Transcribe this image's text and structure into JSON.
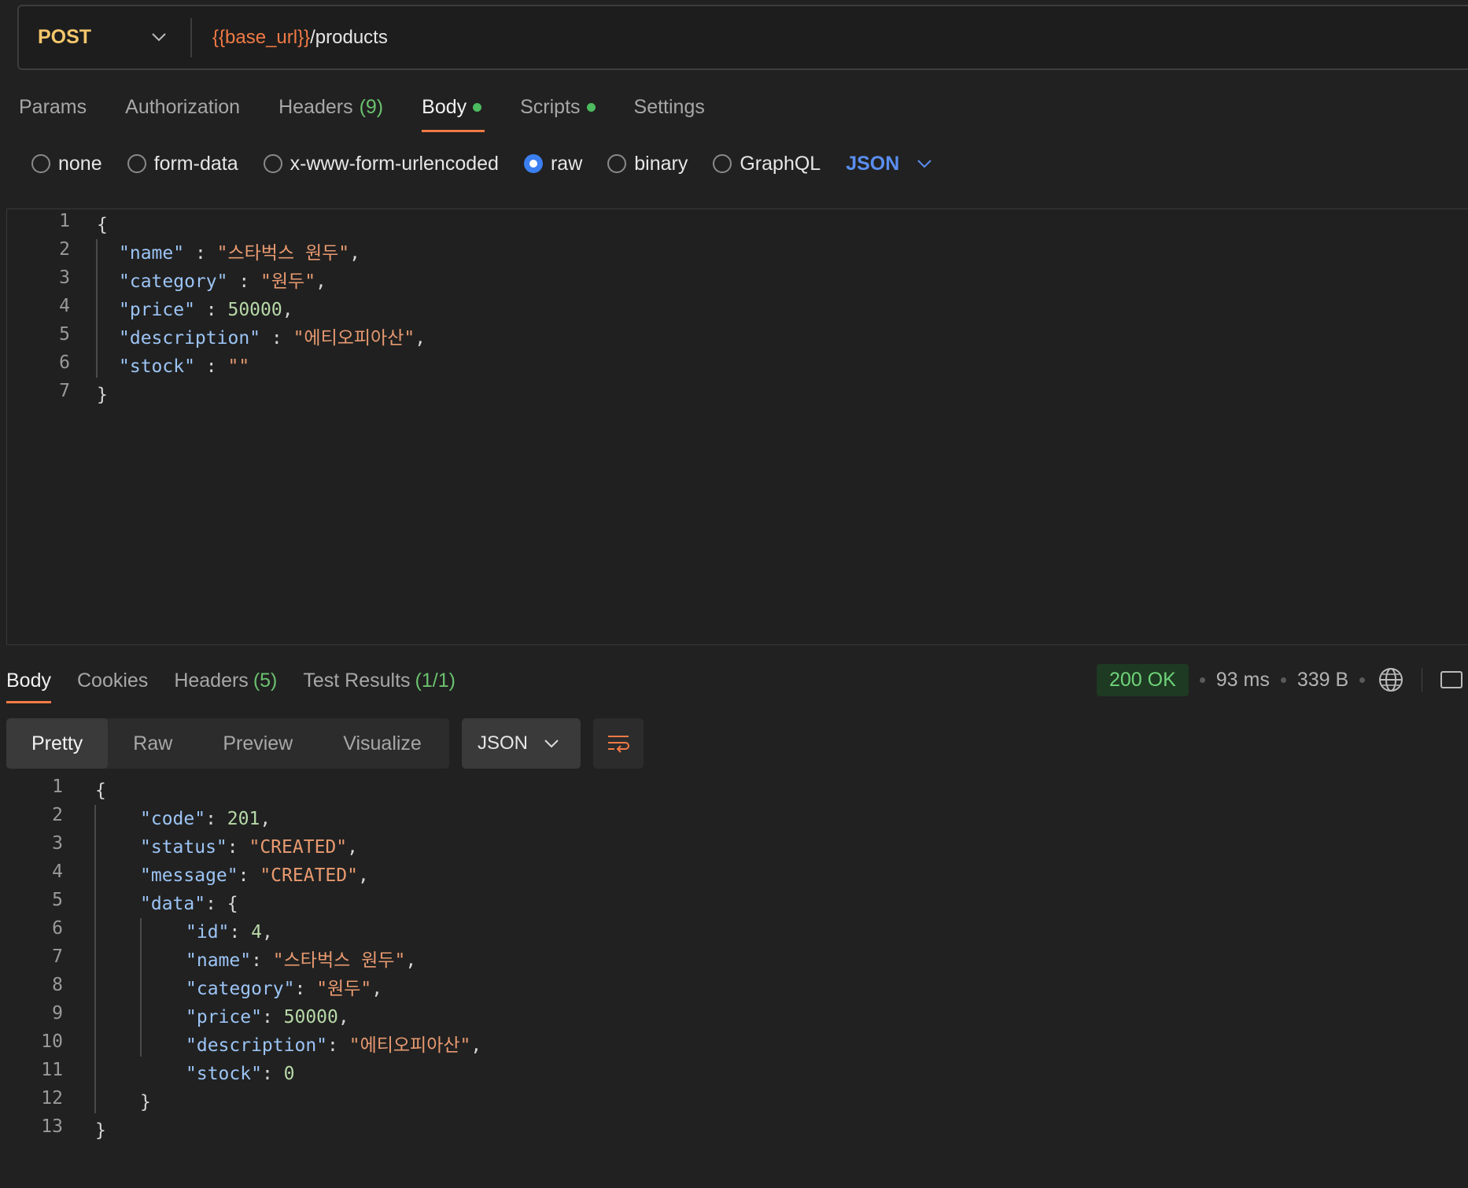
{
  "request": {
    "method": "POST",
    "url_var": "{{base_url}}",
    "url_path": "/products",
    "tabs": [
      {
        "label": "Params"
      },
      {
        "label": "Authorization"
      },
      {
        "label": "Headers",
        "count": "(9)"
      },
      {
        "label": "Body",
        "dot": true
      },
      {
        "label": "Scripts",
        "dot": true
      },
      {
        "label": "Settings"
      }
    ],
    "body_types": [
      "none",
      "form-data",
      "x-www-form-urlencoded",
      "raw",
      "binary",
      "GraphQL"
    ],
    "body_selected": "raw",
    "body_language": "JSON",
    "body_lines": [
      "1",
      "2",
      "3",
      "4",
      "5",
      "6",
      "7"
    ]
  },
  "response": {
    "tabs": [
      {
        "label": "Body"
      },
      {
        "label": "Cookies"
      },
      {
        "label": "Headers",
        "count": "(5)"
      },
      {
        "label": "Test Results",
        "count": "(1/1)"
      }
    ],
    "status": "200 OK",
    "time": "93 ms",
    "size": "339 B",
    "views": [
      "Pretty",
      "Raw",
      "Preview",
      "Visualize"
    ],
    "format": "JSON",
    "line_numbers": [
      "1",
      "2",
      "3",
      "4",
      "5",
      "6",
      "7",
      "8",
      "9",
      "10",
      "11",
      "12",
      "13"
    ]
  },
  "colors": {
    "accent": "#f07a45",
    "method": "#f5c66b",
    "link": "#5a8ef0",
    "success": "#6fd37a"
  }
}
